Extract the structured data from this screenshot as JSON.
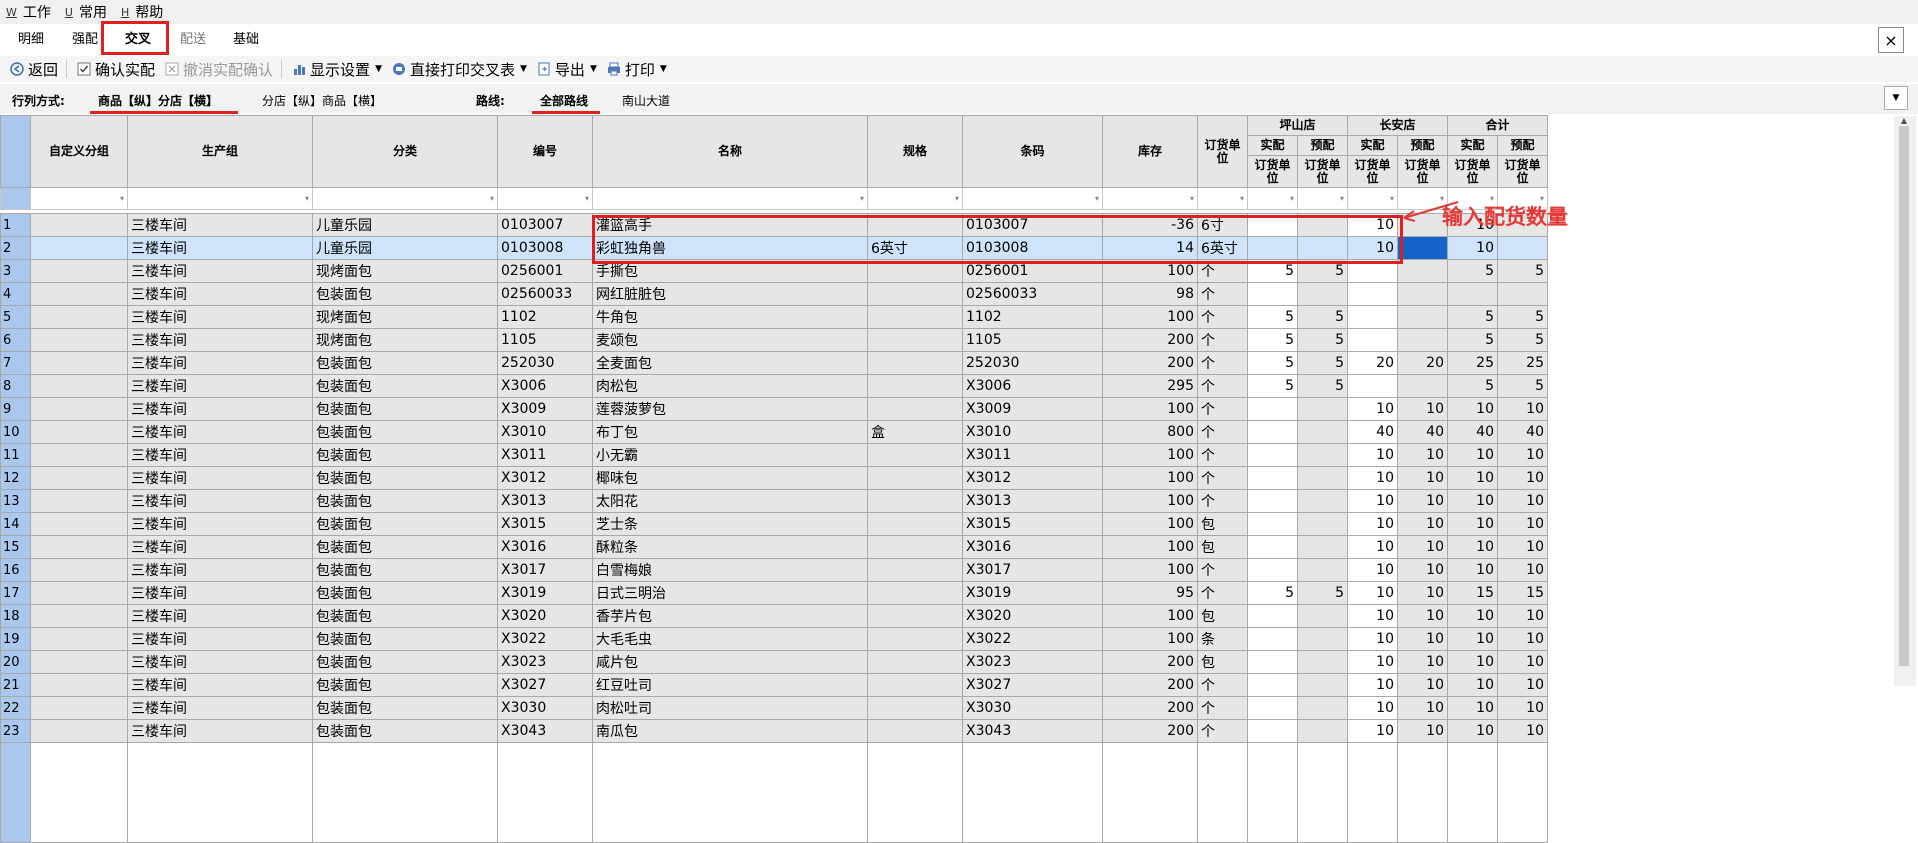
{
  "menu": [
    {
      "key": "W",
      "label": "工作"
    },
    {
      "key": "U",
      "label": "常用"
    },
    {
      "key": "H",
      "label": "帮助"
    }
  ],
  "tabs": [
    {
      "label": "明细",
      "state": "normal"
    },
    {
      "label": "强配",
      "state": "normal"
    },
    {
      "label": "交叉",
      "state": "active"
    },
    {
      "label": "配送",
      "state": "disabled"
    },
    {
      "label": "基础",
      "state": "normal"
    }
  ],
  "close_icon": "×",
  "toolbar": {
    "back": "返回",
    "confirm": "确认实配",
    "cancel_confirm": "撤消实配确认",
    "display_settings": "显示设置",
    "direct_print": "直接打印交叉表",
    "export": "导出",
    "print": "打印"
  },
  "filterbar": {
    "layout_label": "行列方式:",
    "layout_options": [
      "商品【纵】分店【横】",
      "分店【纵】商品【横】"
    ],
    "route_label": "路线:",
    "route_options": [
      "全部路线",
      "南山大道"
    ]
  },
  "columns": {
    "custom_group": "自定义分组",
    "production_group": "生产组",
    "category": "分类",
    "code": "编号",
    "name": "名称",
    "spec": "规格",
    "barcode": "条码",
    "stock": "库存",
    "order_unit": "订货单位",
    "stores": [
      "坪山店",
      "长安店",
      "合计"
    ],
    "sub_actual": "实配",
    "sub_pre": "预配",
    "sub_unit": "订货单位"
  },
  "rows": [
    {
      "n": "1",
      "pg": "三楼车间",
      "cat": "儿童乐园",
      "code": "0103007",
      "name": "灌篮高手",
      "spec": "",
      "bar": "0103007",
      "stock": "-36",
      "unit": "6寸",
      "pa": "",
      "pp": "",
      "ca": "10",
      "cp": "",
      "ta": "10",
      "tp": ""
    },
    {
      "n": "2",
      "pg": "三楼车间",
      "cat": "儿童乐园",
      "code": "0103008",
      "name": "彩虹独角兽",
      "spec": "6英寸",
      "bar": "0103008",
      "stock": "14",
      "unit": "6英寸",
      "pa": "",
      "pp": "",
      "ca": "10",
      "cp": "",
      "ta": "10",
      "tp": ""
    },
    {
      "n": "3",
      "pg": "三楼车间",
      "cat": "现烤面包",
      "code": "0256001",
      "name": "手撕包",
      "spec": "",
      "bar": "0256001",
      "stock": "100",
      "unit": "个",
      "pa": "5",
      "pp": "5",
      "ca": "",
      "cp": "",
      "ta": "5",
      "tp": "5"
    },
    {
      "n": "4",
      "pg": "三楼车间",
      "cat": "包装面包",
      "code": "02560033",
      "name": "网红脏脏包",
      "spec": "",
      "bar": "02560033",
      "stock": "98",
      "unit": "个",
      "pa": "",
      "pp": "",
      "ca": "",
      "cp": "",
      "ta": "",
      "tp": ""
    },
    {
      "n": "5",
      "pg": "三楼车间",
      "cat": "现烤面包",
      "code": "1102",
      "name": "牛角包",
      "spec": "",
      "bar": "1102",
      "stock": "100",
      "unit": "个",
      "pa": "5",
      "pp": "5",
      "ca": "",
      "cp": "",
      "ta": "5",
      "tp": "5"
    },
    {
      "n": "6",
      "pg": "三楼车间",
      "cat": "现烤面包",
      "code": "1105",
      "name": "麦颂包",
      "spec": "",
      "bar": "1105",
      "stock": "200",
      "unit": "个",
      "pa": "5",
      "pp": "5",
      "ca": "",
      "cp": "",
      "ta": "5",
      "tp": "5"
    },
    {
      "n": "7",
      "pg": "三楼车间",
      "cat": "包装面包",
      "code": "252030",
      "name": "全麦面包",
      "spec": "",
      "bar": "252030",
      "stock": "200",
      "unit": "个",
      "pa": "5",
      "pp": "5",
      "ca": "20",
      "cp": "20",
      "ta": "25",
      "tp": "25"
    },
    {
      "n": "8",
      "pg": "三楼车间",
      "cat": "包装面包",
      "code": "X3006",
      "name": "肉松包",
      "spec": "",
      "bar": "X3006",
      "stock": "295",
      "unit": "个",
      "pa": "5",
      "pp": "5",
      "ca": "",
      "cp": "",
      "ta": "5",
      "tp": "5"
    },
    {
      "n": "9",
      "pg": "三楼车间",
      "cat": "包装面包",
      "code": "X3009",
      "name": "莲蓉菠萝包",
      "spec": "",
      "bar": "X3009",
      "stock": "100",
      "unit": "个",
      "pa": "",
      "pp": "",
      "ca": "10",
      "cp": "10",
      "ta": "10",
      "tp": "10"
    },
    {
      "n": "10",
      "pg": "三楼车间",
      "cat": "包装面包",
      "code": "X3010",
      "name": "布丁包",
      "spec": "盒",
      "bar": "X3010",
      "stock": "800",
      "unit": "个",
      "pa": "",
      "pp": "",
      "ca": "40",
      "cp": "40",
      "ta": "40",
      "tp": "40"
    },
    {
      "n": "11",
      "pg": "三楼车间",
      "cat": "包装面包",
      "code": "X3011",
      "name": "小无霸",
      "spec": "",
      "bar": "X3011",
      "stock": "100",
      "unit": "个",
      "pa": "",
      "pp": "",
      "ca": "10",
      "cp": "10",
      "ta": "10",
      "tp": "10"
    },
    {
      "n": "12",
      "pg": "三楼车间",
      "cat": "包装面包",
      "code": "X3012",
      "name": "椰味包",
      "spec": "",
      "bar": "X3012",
      "stock": "100",
      "unit": "个",
      "pa": "",
      "pp": "",
      "ca": "10",
      "cp": "10",
      "ta": "10",
      "tp": "10"
    },
    {
      "n": "13",
      "pg": "三楼车间",
      "cat": "包装面包",
      "code": "X3013",
      "name": "太阳花",
      "spec": "",
      "bar": "X3013",
      "stock": "100",
      "unit": "个",
      "pa": "",
      "pp": "",
      "ca": "10",
      "cp": "10",
      "ta": "10",
      "tp": "10"
    },
    {
      "n": "14",
      "pg": "三楼车间",
      "cat": "包装面包",
      "code": "X3015",
      "name": "芝士条",
      "spec": "",
      "bar": "X3015",
      "stock": "100",
      "unit": "包",
      "pa": "",
      "pp": "",
      "ca": "10",
      "cp": "10",
      "ta": "10",
      "tp": "10"
    },
    {
      "n": "15",
      "pg": "三楼车间",
      "cat": "包装面包",
      "code": "X3016",
      "name": "酥粒条",
      "spec": "",
      "bar": "X3016",
      "stock": "100",
      "unit": "包",
      "pa": "",
      "pp": "",
      "ca": "10",
      "cp": "10",
      "ta": "10",
      "tp": "10"
    },
    {
      "n": "16",
      "pg": "三楼车间",
      "cat": "包装面包",
      "code": "X3017",
      "name": "白雪梅娘",
      "spec": "",
      "bar": "X3017",
      "stock": "100",
      "unit": "个",
      "pa": "",
      "pp": "",
      "ca": "10",
      "cp": "10",
      "ta": "10",
      "tp": "10"
    },
    {
      "n": "17",
      "pg": "三楼车间",
      "cat": "包装面包",
      "code": "X3019",
      "name": "日式三明治",
      "spec": "",
      "bar": "X3019",
      "stock": "95",
      "unit": "个",
      "pa": "5",
      "pp": "5",
      "ca": "10",
      "cp": "10",
      "ta": "15",
      "tp": "15"
    },
    {
      "n": "18",
      "pg": "三楼车间",
      "cat": "包装面包",
      "code": "X3020",
      "name": "香芋片包",
      "spec": "",
      "bar": "X3020",
      "stock": "100",
      "unit": "包",
      "pa": "",
      "pp": "",
      "ca": "10",
      "cp": "10",
      "ta": "10",
      "tp": "10"
    },
    {
      "n": "19",
      "pg": "三楼车间",
      "cat": "包装面包",
      "code": "X3022",
      "name": "大毛毛虫",
      "spec": "",
      "bar": "X3022",
      "stock": "100",
      "unit": "条",
      "pa": "",
      "pp": "",
      "ca": "10",
      "cp": "10",
      "ta": "10",
      "tp": "10"
    },
    {
      "n": "20",
      "pg": "三楼车间",
      "cat": "包装面包",
      "code": "X3023",
      "name": "咸片包",
      "spec": "",
      "bar": "X3023",
      "stock": "200",
      "unit": "包",
      "pa": "",
      "pp": "",
      "ca": "10",
      "cp": "10",
      "ta": "10",
      "tp": "10"
    },
    {
      "n": "21",
      "pg": "三楼车间",
      "cat": "包装面包",
      "code": "X3027",
      "name": "红豆吐司",
      "spec": "",
      "bar": "X3027",
      "stock": "200",
      "unit": "个",
      "pa": "",
      "pp": "",
      "ca": "10",
      "cp": "10",
      "ta": "10",
      "tp": "10"
    },
    {
      "n": "22",
      "pg": "三楼车间",
      "cat": "包装面包",
      "code": "X3030",
      "name": "肉松吐司",
      "spec": "",
      "bar": "X3030",
      "stock": "200",
      "unit": "个",
      "pa": "",
      "pp": "",
      "ca": "10",
      "cp": "10",
      "ta": "10",
      "tp": "10"
    },
    {
      "n": "23",
      "pg": "三楼车间",
      "cat": "包装面包",
      "code": "X3043",
      "name": "南瓜包",
      "spec": "",
      "bar": "X3043",
      "stock": "200",
      "unit": "个",
      "pa": "",
      "pp": "",
      "ca": "10",
      "cp": "10",
      "ta": "10",
      "tp": "10"
    }
  ],
  "annotation": "输入配货数量",
  "colors": {
    "highlight_red": "#e02020",
    "selected_row": "#cfe4fb",
    "current_cell": "#1565c8",
    "row_header": "#aac8ee"
  }
}
